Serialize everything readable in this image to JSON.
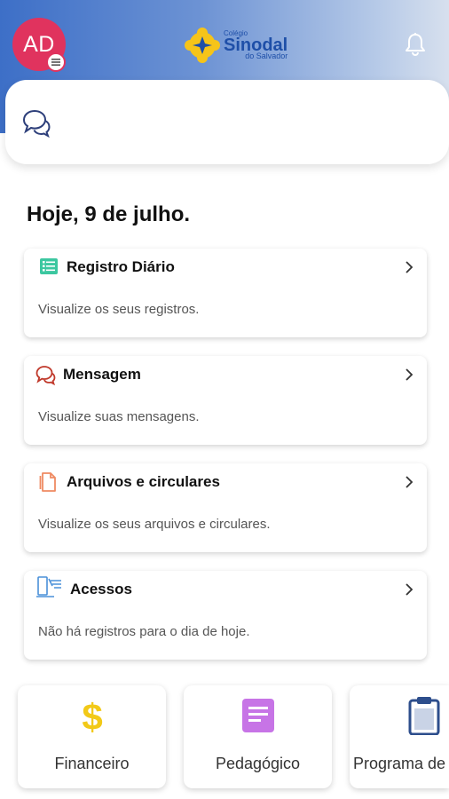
{
  "header": {
    "avatar_initials": "AD",
    "logo": {
      "top": "Colégio",
      "main": "Sinodal",
      "sub": "do Salvador"
    }
  },
  "date_title": "Hoje, 9 de julho.",
  "cards": [
    {
      "title": "Registro Diário",
      "description": "Visualize os seus registros.",
      "icon": "list-icon",
      "color": "#3cc7a0"
    },
    {
      "title": "Mensagem",
      "description": "Visualize suas mensagens.",
      "icon": "chat-icon",
      "color": "#c0392b"
    },
    {
      "title": "Arquivos e circulares",
      "description": "Visualize os seus arquivos e circulares.",
      "icon": "document-icon",
      "color": "#ef8a62"
    },
    {
      "title": "Acessos",
      "description": "Não há registros para o dia de hoje.",
      "icon": "access-icon",
      "color": "#4a90d9"
    }
  ],
  "tiles": [
    {
      "label": "Financeiro",
      "icon": "dollar-icon",
      "color": "#f2c918"
    },
    {
      "label": "Pedagógico",
      "icon": "notes-icon",
      "color": "#c774e6"
    },
    {
      "label": "Programa de",
      "icon": "clipboard-icon",
      "color": "#2d4e8c"
    }
  ],
  "colors": {
    "header_start": "#3d6fc7",
    "header_end": "#d7e0ee",
    "avatar": "#e0335e"
  }
}
